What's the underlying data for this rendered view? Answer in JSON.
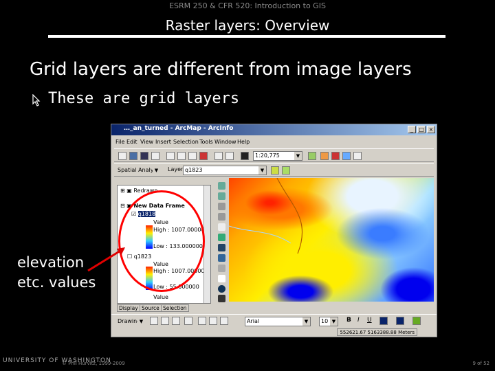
{
  "header": {
    "course": "ESRM 250 & CFR 520: Introduction to GIS",
    "title": "Raster layers: Overview"
  },
  "content": {
    "heading": "Grid layers are different from image layers",
    "bullet": "These are grid layers",
    "callout_line1": "elevation",
    "callout_line2": "etc. values"
  },
  "arcmap": {
    "window_title": "…_an_turned - ArcMap - ArcInfo",
    "menu": [
      "File",
      "Edit",
      "View",
      "Insert",
      "Selection",
      "Tools",
      "Window",
      "Help"
    ],
    "scale": "1:20,775",
    "spatial_analyst": "Spatial Analyst",
    "layer_label": "Layer:",
    "layer_value": "q1823",
    "toc": {
      "layer_top": "Redrawn…",
      "frame": "New Data Frame",
      "layer1": "q1818",
      "value_label": "Value",
      "high1": "High : 1007.000000",
      "low1": "Low : 133.000000",
      "layer2": "q1823",
      "high2": "High : 1007.000000",
      "low2": "Low : 55.000000",
      "value3": "Value"
    },
    "tabs": [
      "Display",
      "Source",
      "Selection"
    ],
    "drawing": "Drawing",
    "font": "Arial",
    "font_size": "10",
    "coords": "552621.67 5163388.88 Meters"
  },
  "footer": {
    "logo": "UNIVERSITY OF WASHINGTON",
    "copyright": "© Phil Hurvitz, 1999-2009",
    "page": "9 of 52"
  },
  "colors": {
    "background": "#000000",
    "callout_red": "#ff0000"
  }
}
